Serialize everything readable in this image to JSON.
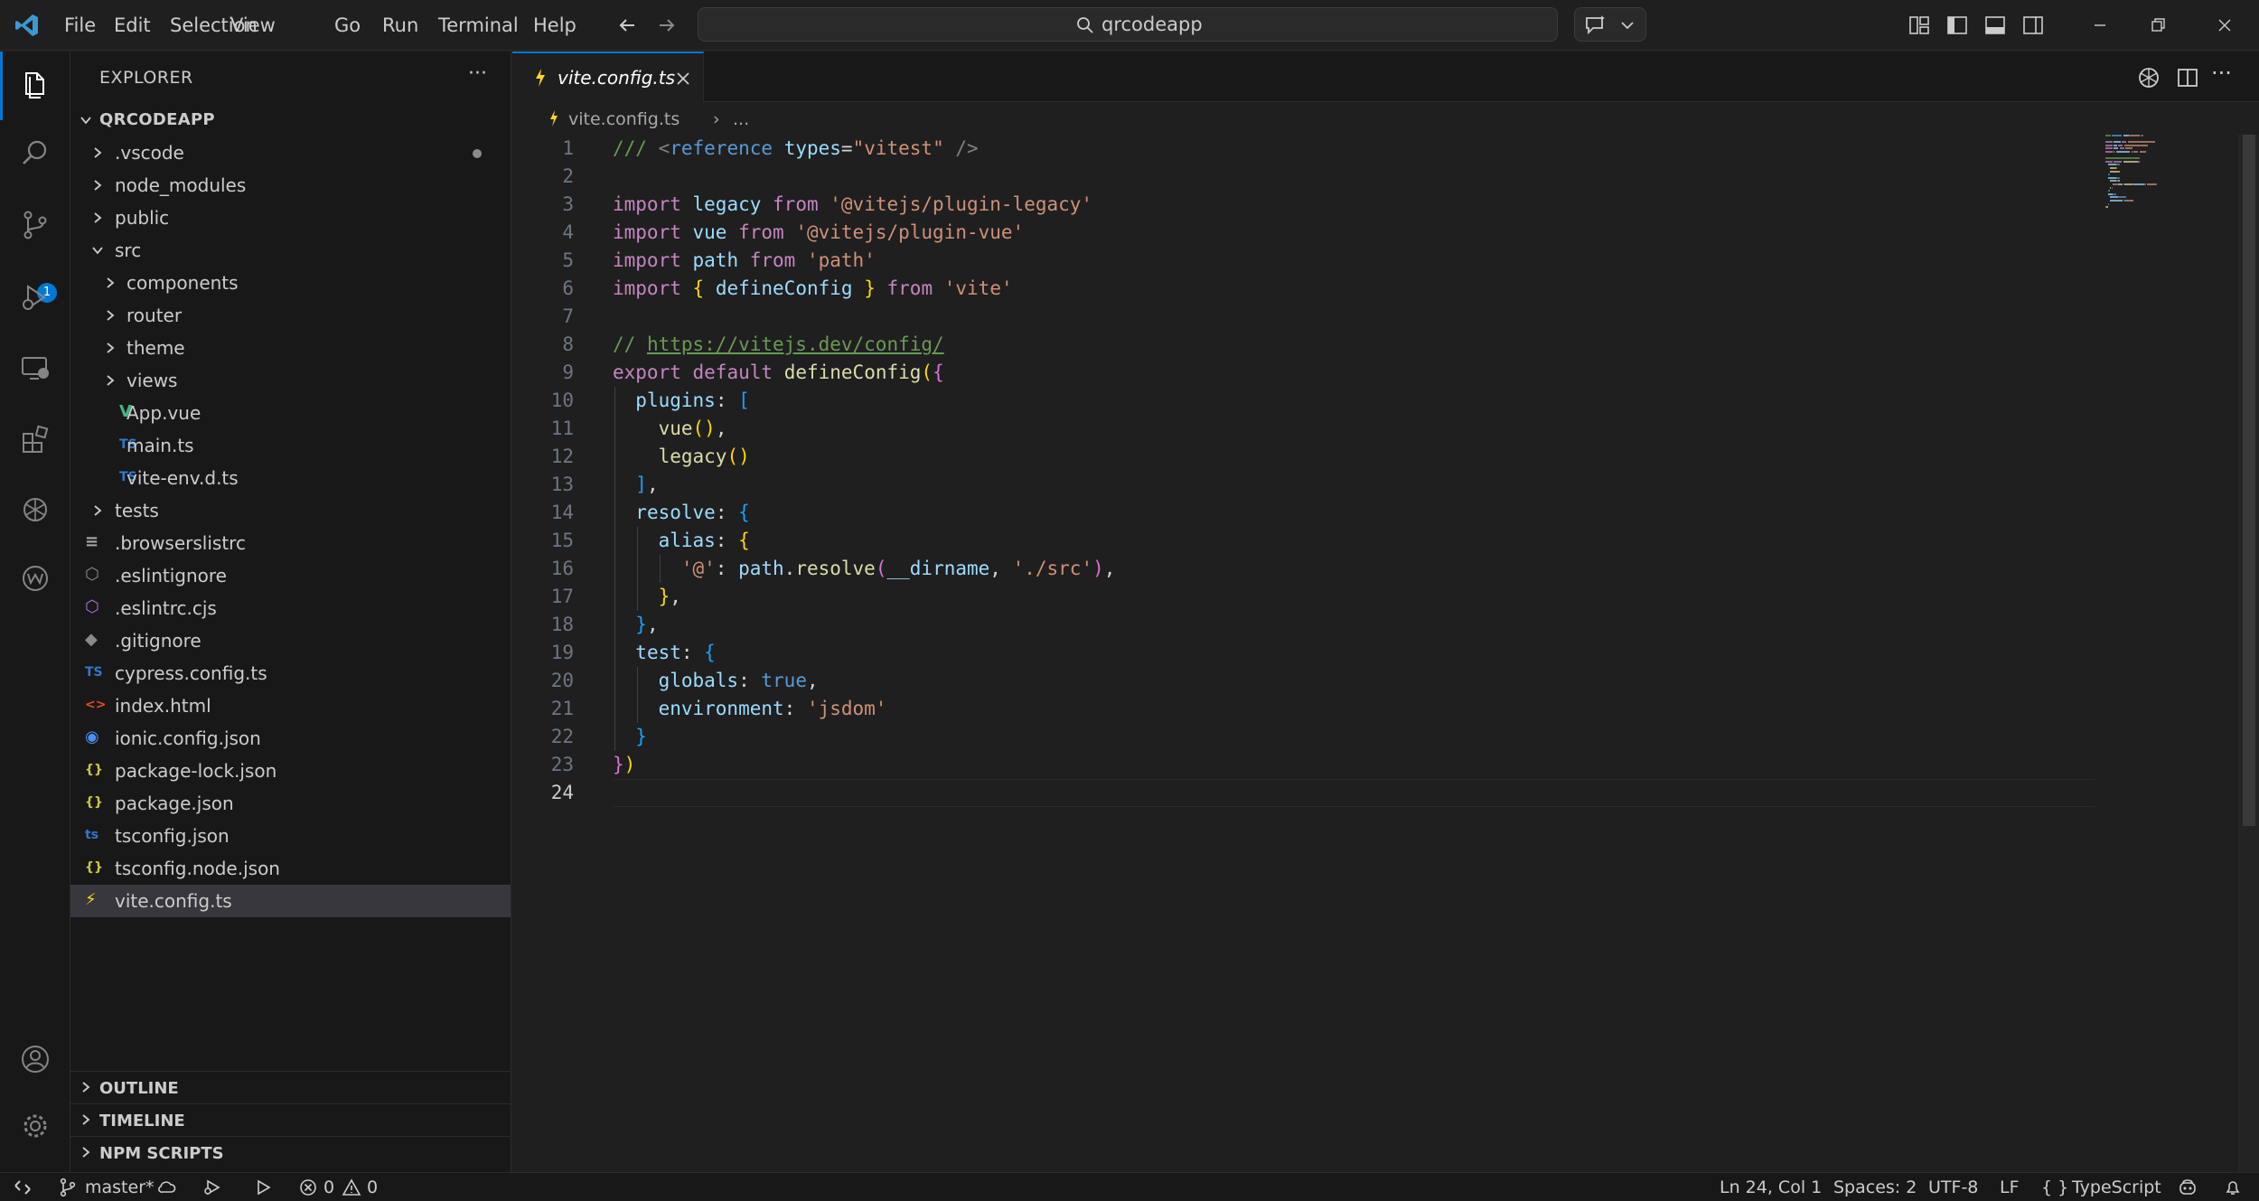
{
  "window": {
    "menu": [
      "File",
      "Edit",
      "Selection",
      "View",
      "Go",
      "Run",
      "Terminal",
      "Help"
    ],
    "search_label": "qrcodeapp"
  },
  "activity": {
    "icons": [
      "explorer-icon",
      "search-icon",
      "source-control-icon",
      "run-debug-icon",
      "remote-explorer-icon",
      "extensions-icon",
      "chatgpt-icon",
      "codeium-icon",
      "account-icon",
      "settings-gear-icon"
    ],
    "scm_badge": "1",
    "accent_color": "#0078d4"
  },
  "sidebar": {
    "title": "EXPLORER",
    "more": "···",
    "root": "QRCODEAPP",
    "tree": [
      {
        "label": ".vscode",
        "kind": "folder",
        "depth": 1,
        "open": false,
        "dirty": true
      },
      {
        "label": "node_modules",
        "kind": "folder",
        "depth": 1,
        "open": false
      },
      {
        "label": "public",
        "kind": "folder",
        "depth": 1,
        "open": false
      },
      {
        "label": "src",
        "kind": "folder",
        "depth": 1,
        "open": true
      },
      {
        "label": "components",
        "kind": "folder",
        "depth": 2,
        "open": false
      },
      {
        "label": "router",
        "kind": "folder",
        "depth": 2,
        "open": false
      },
      {
        "label": "theme",
        "kind": "folder",
        "depth": 2,
        "open": false
      },
      {
        "label": "views",
        "kind": "folder",
        "depth": 2,
        "open": false
      },
      {
        "label": "App.vue",
        "kind": "file",
        "icon": "vue",
        "depth": 2
      },
      {
        "label": "main.ts",
        "kind": "file",
        "icon": "ts",
        "depth": 2
      },
      {
        "label": "vite-env.d.ts",
        "kind": "file",
        "icon": "ts",
        "depth": 2
      },
      {
        "label": "tests",
        "kind": "folder",
        "depth": 1,
        "open": false
      },
      {
        "label": ".browserslistrc",
        "kind": "file",
        "icon": "lines",
        "depth": 1
      },
      {
        "label": ".eslintignore",
        "kind": "file",
        "icon": "eslint-grey",
        "depth": 1
      },
      {
        "label": ".eslintrc.cjs",
        "kind": "file",
        "icon": "eslint",
        "depth": 1
      },
      {
        "label": ".gitignore",
        "kind": "file",
        "icon": "git",
        "depth": 1
      },
      {
        "label": "cypress.config.ts",
        "kind": "file",
        "icon": "ts",
        "depth": 1
      },
      {
        "label": "index.html",
        "kind": "file",
        "icon": "html",
        "depth": 1
      },
      {
        "label": "ionic.config.json",
        "kind": "file",
        "icon": "ionic",
        "depth": 1
      },
      {
        "label": "package-lock.json",
        "kind": "file",
        "icon": "json",
        "depth": 1
      },
      {
        "label": "package.json",
        "kind": "file",
        "icon": "json",
        "depth": 1
      },
      {
        "label": "tsconfig.json",
        "kind": "file",
        "icon": "tsconfig",
        "depth": 1
      },
      {
        "label": "tsconfig.node.json",
        "kind": "file",
        "icon": "json",
        "depth": 1
      },
      {
        "label": "vite.config.ts",
        "kind": "file",
        "icon": "vite",
        "depth": 1,
        "selected": true
      }
    ],
    "panels": [
      "OUTLINE",
      "TIMELINE",
      "NPM SCRIPTS"
    ]
  },
  "editor": {
    "tab": "vite.config.ts",
    "breadcrumb": {
      "file": "vite.config.ts",
      "sep": "›",
      "more": "..."
    },
    "current_line": 24,
    "lines": [
      [
        [
          "cm",
          "/// "
        ],
        [
          "tag",
          "<"
        ],
        [
          "bool",
          "reference"
        ],
        [
          "p",
          " "
        ],
        [
          "id",
          "types"
        ],
        [
          "p",
          "="
        ],
        [
          "str",
          "\"vitest\""
        ],
        [
          "p",
          " "
        ],
        [
          "tag",
          "/>"
        ]
      ],
      [],
      [
        [
          "kw",
          "import"
        ],
        [
          "p",
          " "
        ],
        [
          "id",
          "legacy"
        ],
        [
          "p",
          " "
        ],
        [
          "kw",
          "from"
        ],
        [
          "p",
          " "
        ],
        [
          "str",
          "'@vitejs/plugin-legacy'"
        ]
      ],
      [
        [
          "kw",
          "import"
        ],
        [
          "p",
          " "
        ],
        [
          "id",
          "vue"
        ],
        [
          "p",
          " "
        ],
        [
          "kw",
          "from"
        ],
        [
          "p",
          " "
        ],
        [
          "str",
          "'@vitejs/plugin-vue'"
        ]
      ],
      [
        [
          "kw",
          "import"
        ],
        [
          "p",
          " "
        ],
        [
          "id",
          "path"
        ],
        [
          "p",
          " "
        ],
        [
          "kw",
          "from"
        ],
        [
          "p",
          " "
        ],
        [
          "str",
          "'path'"
        ]
      ],
      [
        [
          "kw",
          "import"
        ],
        [
          "p",
          " "
        ],
        [
          "b1",
          "{"
        ],
        [
          "p",
          " "
        ],
        [
          "id",
          "defineConfig"
        ],
        [
          "p",
          " "
        ],
        [
          "b1",
          "}"
        ],
        [
          "p",
          " "
        ],
        [
          "kw",
          "from"
        ],
        [
          "p",
          " "
        ],
        [
          "str",
          "'vite'"
        ]
      ],
      [],
      [
        [
          "cm",
          "// "
        ],
        [
          "url",
          "https://vitejs.dev/config/"
        ]
      ],
      [
        [
          "kw",
          "export"
        ],
        [
          "p",
          " "
        ],
        [
          "kw",
          "default"
        ],
        [
          "p",
          " "
        ],
        [
          "fn",
          "defineConfig"
        ],
        [
          "b1",
          "("
        ],
        [
          "b2",
          "{"
        ]
      ],
      [
        [
          "p",
          "  "
        ],
        [
          "id",
          "plugins"
        ],
        [
          "p",
          ": "
        ],
        [
          "b3",
          "["
        ]
      ],
      [
        [
          "p",
          "    "
        ],
        [
          "fn",
          "vue"
        ],
        [
          "b1",
          "()"
        ],
        [
          "p",
          ","
        ]
      ],
      [
        [
          "p",
          "    "
        ],
        [
          "fn",
          "legacy"
        ],
        [
          "b1",
          "()"
        ]
      ],
      [
        [
          "p",
          "  "
        ],
        [
          "b3",
          "]"
        ],
        [
          "p",
          ","
        ]
      ],
      [
        [
          "p",
          "  "
        ],
        [
          "id",
          "resolve"
        ],
        [
          "p",
          ": "
        ],
        [
          "b3",
          "{"
        ]
      ],
      [
        [
          "p",
          "    "
        ],
        [
          "id",
          "alias"
        ],
        [
          "p",
          ": "
        ],
        [
          "b1",
          "{"
        ]
      ],
      [
        [
          "p",
          "      "
        ],
        [
          "str",
          "'@'"
        ],
        [
          "p",
          ": "
        ],
        [
          "id",
          "path"
        ],
        [
          "p",
          "."
        ],
        [
          "fn",
          "resolve"
        ],
        [
          "b2",
          "("
        ],
        [
          "id",
          "__dirname"
        ],
        [
          "p",
          ", "
        ],
        [
          "str",
          "'./src'"
        ],
        [
          "b2",
          ")"
        ],
        [
          "p",
          ","
        ]
      ],
      [
        [
          "p",
          "    "
        ],
        [
          "b1",
          "}"
        ],
        [
          "p",
          ","
        ]
      ],
      [
        [
          "p",
          "  "
        ],
        [
          "b3",
          "}"
        ],
        [
          "p",
          ","
        ]
      ],
      [
        [
          "p",
          "  "
        ],
        [
          "id",
          "test"
        ],
        [
          "p",
          ": "
        ],
        [
          "b3",
          "{"
        ]
      ],
      [
        [
          "p",
          "    "
        ],
        [
          "id",
          "globals"
        ],
        [
          "p",
          ": "
        ],
        [
          "bool",
          "true"
        ],
        [
          "p",
          ","
        ]
      ],
      [
        [
          "p",
          "    "
        ],
        [
          "id",
          "environment"
        ],
        [
          "p",
          ": "
        ],
        [
          "str",
          "'jsdom'"
        ]
      ],
      [
        [
          "p",
          "  "
        ],
        [
          "b3",
          "}"
        ]
      ],
      [
        [
          "b2",
          "}"
        ],
        [
          "b1",
          ")"
        ]
      ],
      []
    ]
  },
  "statusbar": {
    "branch": "master*",
    "errors": "0",
    "warnings": "0",
    "position": "Ln 24, Col 1",
    "spaces": "Spaces: 2",
    "encoding": "UTF-8",
    "eol": "LF",
    "braces": "{ }",
    "language": "TypeScript"
  }
}
